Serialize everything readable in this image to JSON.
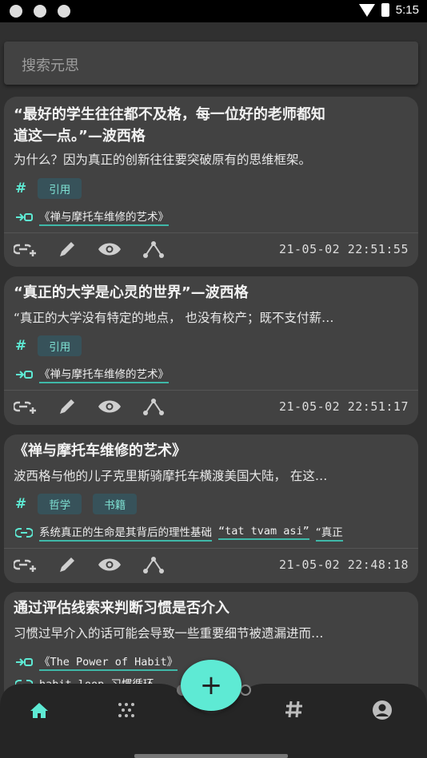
{
  "status_bar": {
    "time": "5:15"
  },
  "search": {
    "placeholder": "搜索元思"
  },
  "cards": [
    {
      "title_line1": "“最好的学生往往都不及格，每一位好的老师都知",
      "title_line2": "道这一点。”—波西格",
      "body": "为什么？因为真正的创新往往要突破原有的思维框架。",
      "tags": [
        "引用"
      ],
      "links": [
        "《禅与摩托车维修的艺术》"
      ],
      "timestamp": "21-05-02 22:51:55"
    },
    {
      "title_line1": "“真正的大学是心灵的世界”—波西格",
      "body": "“真正的大学没有特定的地点， 也没有校产；既不支付薪…",
      "tags": [
        "引用"
      ],
      "links": [
        "《禅与摩托车维修的艺术》"
      ],
      "timestamp": "21-05-02 22:51:17"
    },
    {
      "title_line1": "《禅与摩托车维修的艺术》",
      "body": "波西格与他的儿子克里斯骑摩托车横渡美国大陆， 在这…",
      "tags": [
        "哲学",
        "书籍"
      ],
      "links": [
        "系统真正的生命是其背后的理性基础",
        "“tat tvam asi”",
        "“真正"
      ],
      "timestamp": "21-05-02 22:48:18"
    },
    {
      "title_line1": "通过评估线索来判断习惯是否介入",
      "body": "习惯过早介入的话可能会导致一些重要细节被遗漏进而…",
      "links": [
        "《The Power of Habit》",
        "habit loop 习惯循环"
      ]
    }
  ],
  "fab": {
    "label": "+"
  },
  "bottom_nav": [
    "home-icon",
    "graph-icon",
    "tag-icon",
    "account-icon"
  ],
  "colors": {
    "accent": "#5eead4",
    "card": "#424242",
    "background": "#303030",
    "tag_bg": "#37525a"
  }
}
